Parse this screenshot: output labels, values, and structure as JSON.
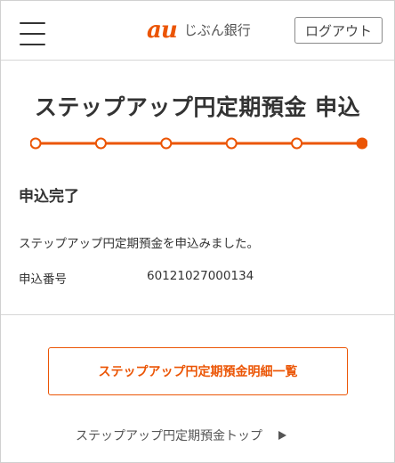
{
  "header": {
    "brand_mark": "au",
    "brand_name": "じぶん銀行",
    "logout_label": "ログアウト"
  },
  "page": {
    "title": "ステップアップ円定期預金 申込"
  },
  "stepper": {
    "total_steps": 6,
    "current_step": 6,
    "accent_color": "#eb5505"
  },
  "result": {
    "heading": "申込完了",
    "message": "ステップアップ円定期預金を申込みました。",
    "application_number_label": "申込番号",
    "application_number": "60121027000134"
  },
  "actions": {
    "detail_list_label": "ステップアップ円定期預金明細一覧",
    "top_link_label": "ステップアップ円定期預金トップ"
  }
}
